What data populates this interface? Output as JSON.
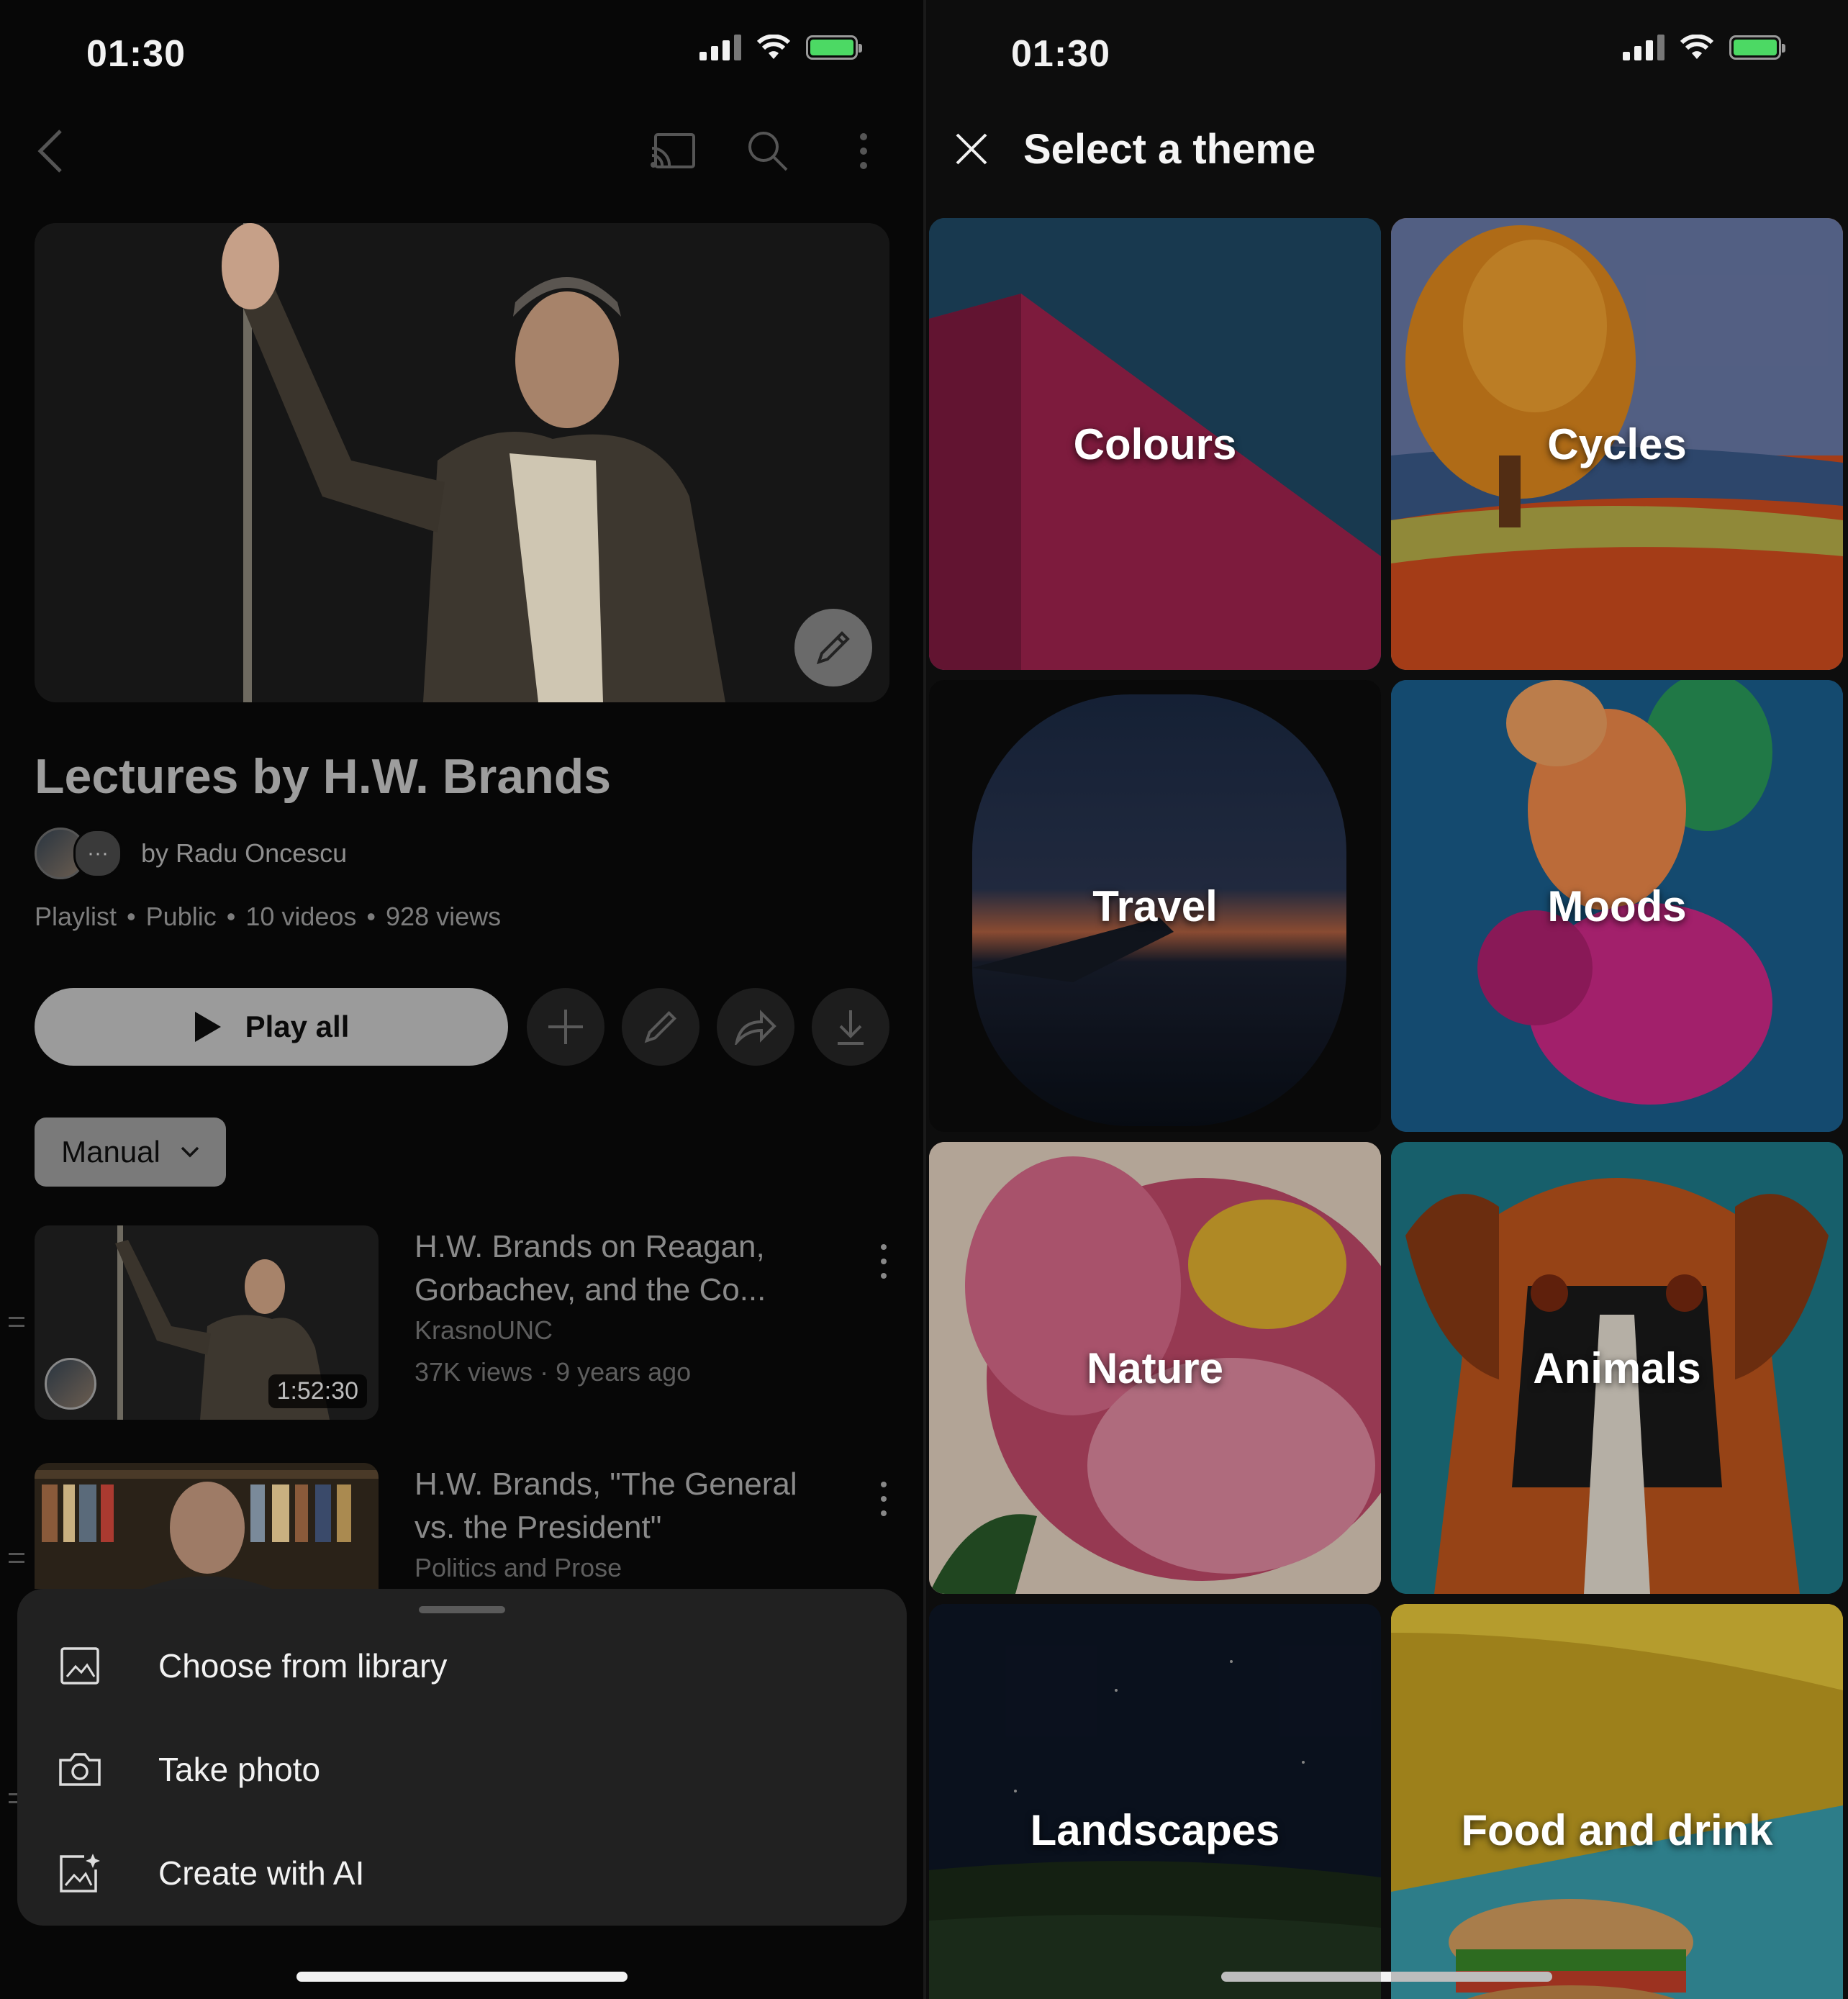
{
  "left": {
    "status": {
      "time": "01:30"
    },
    "playlist": {
      "title": "Lectures by H.W. Brands",
      "owner": "by Radu Oncescu",
      "meta": [
        "Playlist",
        "Public",
        "10 videos",
        "928 views"
      ],
      "play_all": "Play all",
      "sort": "Manual"
    },
    "videos": [
      {
        "title": "H.W. Brands on Reagan, Gorbachev, and the Co...",
        "channel": "KrasnoUNC",
        "stats": "37K views · 9 years ago",
        "duration": "1:52:30"
      },
      {
        "title": "H.W. Brands, \"The General vs. the President\"",
        "channel": "Politics and Prose"
      }
    ],
    "sheet": {
      "items": [
        {
          "label": "Choose from library",
          "icon": "image-icon"
        },
        {
          "label": "Take photo",
          "icon": "camera-icon"
        },
        {
          "label": "Create with AI",
          "icon": "ai-image-icon"
        }
      ]
    }
  },
  "right": {
    "status": {
      "time": "01:30"
    },
    "title": "Select a theme",
    "themes": [
      {
        "label": "Colours",
        "color": "#a0234f"
      },
      {
        "label": "Cycles",
        "color": "#d2631b"
      },
      {
        "label": "Travel",
        "color": "#1b2433"
      },
      {
        "label": "Moods",
        "color": "#1a5f8f"
      },
      {
        "label": "Nature",
        "color": "#d8b4a0"
      },
      {
        "label": "Animals",
        "color": "#c0561d"
      },
      {
        "label": "Landscapes",
        "color": "#121a2a"
      },
      {
        "label": "Food and drink",
        "color": "#c9a523"
      }
    ]
  }
}
